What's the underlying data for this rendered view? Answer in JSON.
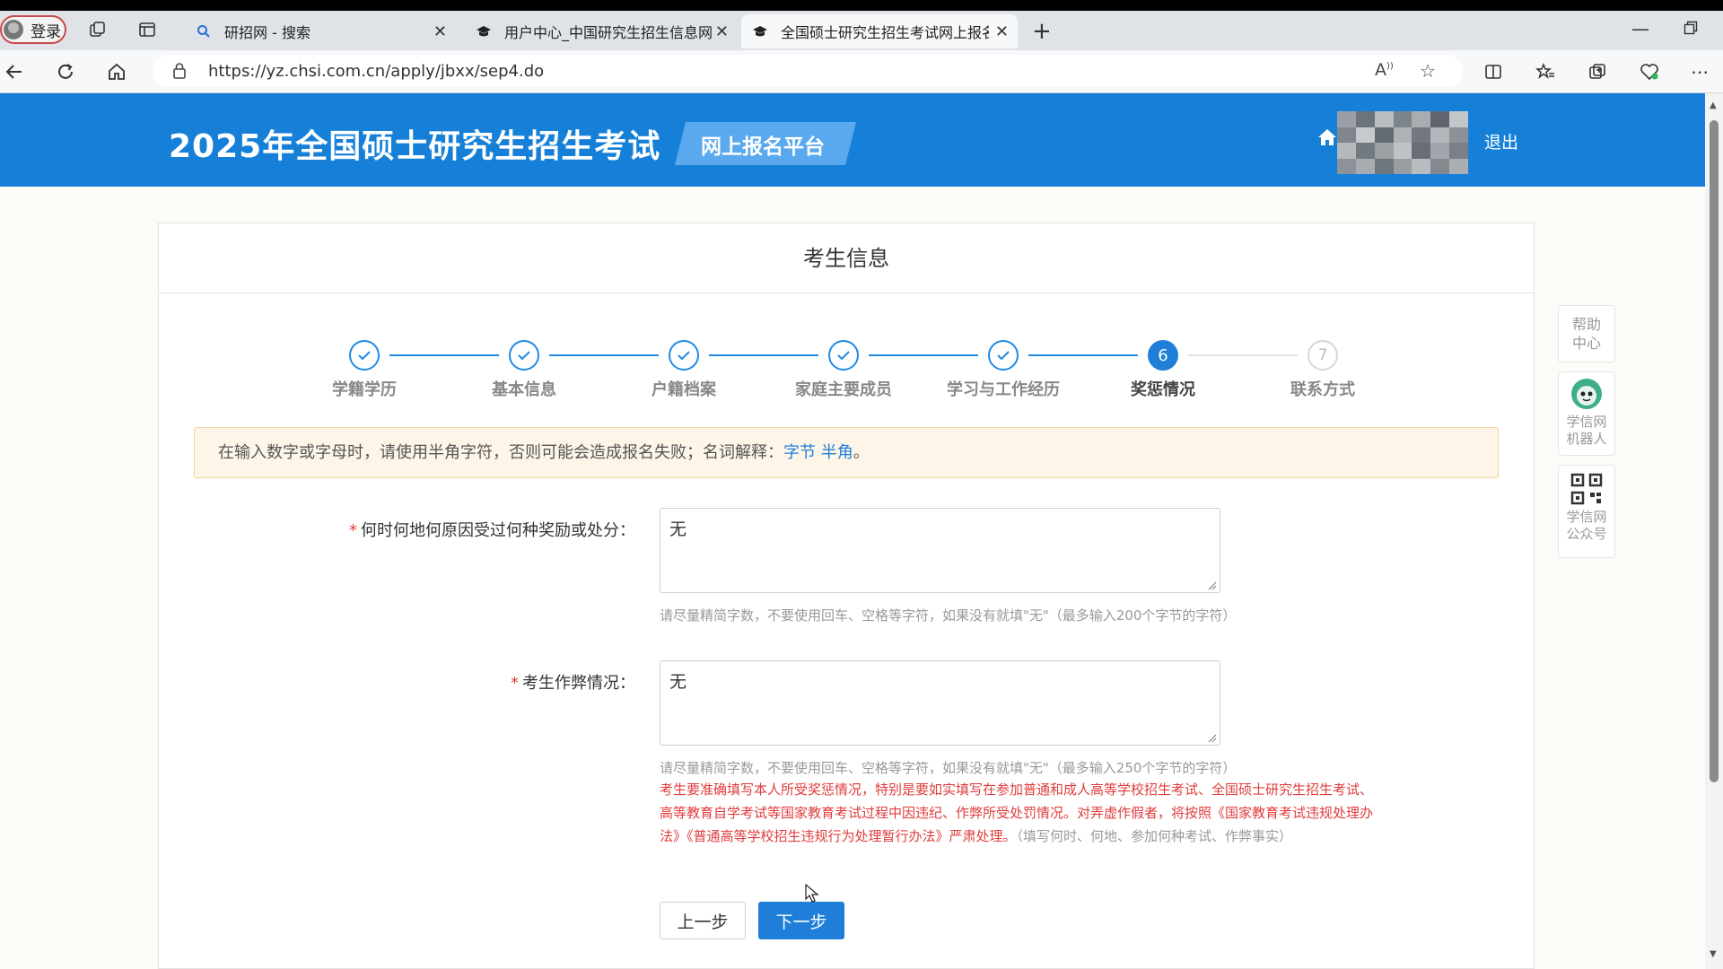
{
  "browser": {
    "profile_label": "登录",
    "tabs": [
      {
        "title": "研招网 - 搜索",
        "icon": "search-icon"
      },
      {
        "title": "用户中心_中国研究生招生信息网",
        "icon": "mortarboard-icon"
      },
      {
        "title": "全国硕士研究生招生考试网上报名",
        "icon": "mortarboard-icon"
      }
    ],
    "url": "https://yz.chsi.com.cn/apply/jbxx/sep4.do"
  },
  "header": {
    "title": "2025年全国硕士研究生招生考试",
    "platform": "网上报名平台",
    "logout": "退出",
    "color": "#1680d9"
  },
  "card": {
    "title": "考生信息"
  },
  "steps": [
    {
      "label": "学籍学历",
      "state": "done"
    },
    {
      "label": "基本信息",
      "state": "done"
    },
    {
      "label": "户籍档案",
      "state": "done"
    },
    {
      "label": "家庭主要成员",
      "state": "done"
    },
    {
      "label": "学习与工作经历",
      "state": "done"
    },
    {
      "label": "奖惩情况",
      "state": "current",
      "number": "6"
    },
    {
      "label": "联系方式",
      "state": "todo",
      "number": "7"
    }
  ],
  "notice": {
    "text": "在输入数字或字母时，请使用半角字符，否则可能会造成报名失败；名词解释：",
    "link_byte": "字节",
    "link_halfwidth": "半角",
    "end": "。"
  },
  "form": {
    "rewards": {
      "label": "何时何地何原因受过何种奖励或处分：",
      "value": "无",
      "hint": "请尽量精简字数，不要使用回车、空格等字符，如果没有就填\"无\"（最多输入200个字节的字符）"
    },
    "cheating": {
      "label": "考生作弊情况：",
      "value": "无",
      "hint": "请尽量精简字数，不要使用回车、空格等字符，如果没有就填\"无\"（最多输入250个字节的字符）"
    },
    "warning_red": "考生要准确填写本人所受奖惩情况，特别是要如实填写在参加普通和成人高等学校招生考试、全国硕士研究生招生考试、高等教育自学考试等国家教育考试过程中因违纪、作弊所受处罚情况。对弄虚作假者，将按照《国家教育考试违规处理办法》《普通高等学校招生违规行为处理暂行办法》严肃处理。",
    "warning_gray": "（填写何时、何地、参加何种考试、作弊事实）"
  },
  "buttons": {
    "prev": "上一步",
    "next": "下一步"
  },
  "sidebar": {
    "help": "帮助中心",
    "robot": "学信网机器人",
    "wechat": "学信网公众号"
  }
}
